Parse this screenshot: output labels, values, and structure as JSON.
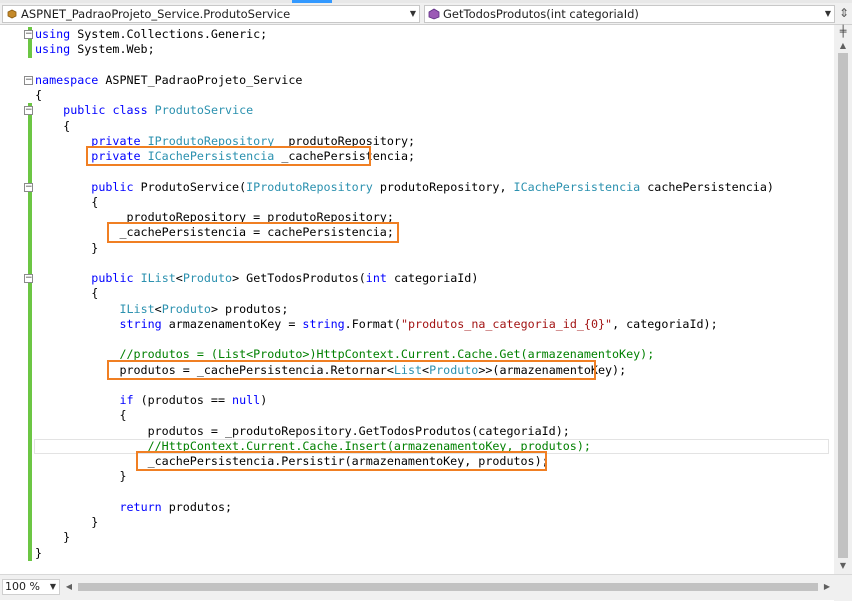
{
  "navigation": {
    "type_dropdown": {
      "icon": "class-icon",
      "value": "ASPNET_PadraoProjeto_Service.ProdutoService"
    },
    "member_dropdown": {
      "icon": "method-icon",
      "value": "GetTodosProdutos(int categoriaId)"
    }
  },
  "code": {
    "lines": [
      [
        {
          "t": "using",
          "c": "kw"
        },
        {
          "t": " System.Collections.Generic;"
        }
      ],
      [
        {
          "t": "using",
          "c": "kw"
        },
        {
          "t": " System.Web;"
        }
      ],
      [],
      [
        {
          "t": "namespace",
          "c": "kw"
        },
        {
          "t": " ASPNET_PadraoProjeto_Service"
        }
      ],
      [
        {
          "t": "{"
        }
      ],
      [
        {
          "t": "    "
        },
        {
          "t": "public",
          "c": "kw"
        },
        {
          "t": " "
        },
        {
          "t": "class",
          "c": "kw"
        },
        {
          "t": " "
        },
        {
          "t": "ProdutoService",
          "c": "ty"
        }
      ],
      [
        {
          "t": "    {"
        }
      ],
      [
        {
          "t": "        "
        },
        {
          "t": "private",
          "c": "kw"
        },
        {
          "t": " "
        },
        {
          "t": "IProdutoRepository",
          "c": "ty"
        },
        {
          "t": " _produtoRepository;"
        }
      ],
      [
        {
          "t": "        "
        },
        {
          "t": "private",
          "c": "kw"
        },
        {
          "t": " "
        },
        {
          "t": "ICachePersistencia",
          "c": "ty"
        },
        {
          "t": " _cachePersistencia;"
        }
      ],
      [],
      [
        {
          "t": "        "
        },
        {
          "t": "public",
          "c": "kw"
        },
        {
          "t": " ProdutoService("
        },
        {
          "t": "IProdutoRepository",
          "c": "ty"
        },
        {
          "t": " produtoRepository, "
        },
        {
          "t": "ICachePersistencia",
          "c": "ty"
        },
        {
          "t": " cachePersistencia)"
        }
      ],
      [
        {
          "t": "        {"
        }
      ],
      [
        {
          "t": "            _produtoRepository = produtoRepository;"
        }
      ],
      [
        {
          "t": "            _cachePersistencia = cachePersistencia;"
        }
      ],
      [
        {
          "t": "        }"
        }
      ],
      [],
      [
        {
          "t": "        "
        },
        {
          "t": "public",
          "c": "kw"
        },
        {
          "t": " "
        },
        {
          "t": "IList",
          "c": "ty"
        },
        {
          "t": "<"
        },
        {
          "t": "Produto",
          "c": "ty"
        },
        {
          "t": "> GetTodosProdutos("
        },
        {
          "t": "int",
          "c": "kw"
        },
        {
          "t": " categoriaId)"
        }
      ],
      [
        {
          "t": "        {"
        }
      ],
      [
        {
          "t": "            "
        },
        {
          "t": "IList",
          "c": "ty"
        },
        {
          "t": "<"
        },
        {
          "t": "Produto",
          "c": "ty"
        },
        {
          "t": "> produtos;"
        }
      ],
      [
        {
          "t": "            "
        },
        {
          "t": "string",
          "c": "kw"
        },
        {
          "t": " armazenamentoKey = "
        },
        {
          "t": "string",
          "c": "kw"
        },
        {
          "t": ".Format("
        },
        {
          "t": "\"produtos_na_categoria_id_{0}\"",
          "c": "str"
        },
        {
          "t": ", categoriaId);"
        }
      ],
      [],
      [
        {
          "t": "            "
        },
        {
          "t": "//produtos = (List<Produto>)HttpContext.Current.Cache.Get(armazenamentoKey);",
          "c": "cm"
        }
      ],
      [
        {
          "t": "            produtos = _cachePersistencia.Retornar<"
        },
        {
          "t": "List",
          "c": "ty"
        },
        {
          "t": "<"
        },
        {
          "t": "Produto",
          "c": "ty"
        },
        {
          "t": ">>(armazenamentoKey);"
        }
      ],
      [],
      [
        {
          "t": "            "
        },
        {
          "t": "if",
          "c": "kw"
        },
        {
          "t": " (produtos == "
        },
        {
          "t": "null",
          "c": "kw"
        },
        {
          "t": ")"
        }
      ],
      [
        {
          "t": "            {"
        }
      ],
      [
        {
          "t": "                produtos = _produtoRepository.GetTodosProdutos(categoriaId);"
        }
      ],
      [
        {
          "t": "                "
        },
        {
          "t": "//HttpContext.Current.Cache.Insert(armazenamentoKey, produtos);",
          "c": "cm"
        }
      ],
      [
        {
          "t": "                _cachePersistencia.Persistir(armazenamentoKey, produtos);"
        }
      ],
      [
        {
          "t": "            }"
        }
      ],
      [],
      [
        {
          "t": "            "
        },
        {
          "t": "return",
          "c": "kw"
        },
        {
          "t": " produtos;"
        }
      ],
      [
        {
          "t": "        }"
        }
      ],
      [
        {
          "t": "    }"
        }
      ],
      [
        {
          "t": "}"
        }
      ]
    ]
  },
  "colors": {
    "keyword": "#0000ff",
    "type": "#2b91af",
    "string": "#a31515",
    "comment": "#008000",
    "highlight_box": "#f07f23",
    "change_bar": "#6cc644"
  },
  "status": {
    "zoom": "100 %"
  }
}
